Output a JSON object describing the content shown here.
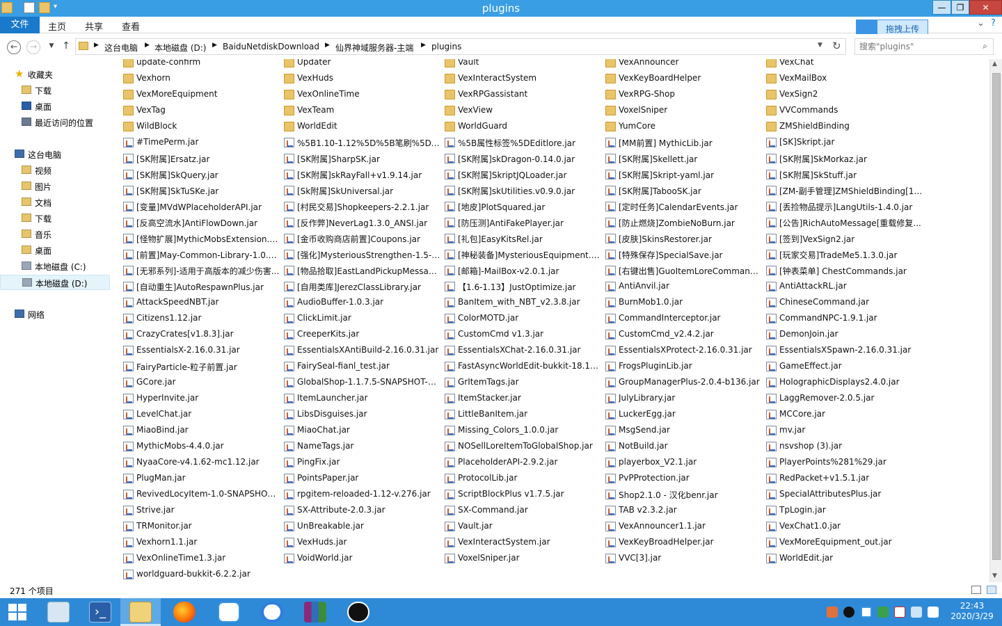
{
  "window": {
    "title": "plugins",
    "minimize": "—",
    "maximize": "❐",
    "close": "✕"
  },
  "ribbon": {
    "tabs": [
      "文件",
      "主页",
      "共享",
      "查看"
    ],
    "upload_label": "拖拽上传",
    "expand": "⌄",
    "help": "?"
  },
  "address": {
    "crumbs": [
      "这台电脑",
      "本地磁盘 (D:)",
      "BaiduNetdiskDownload",
      "仙界神域服务器-主端",
      "plugins"
    ],
    "search_placeholder": "搜索\"plugins\""
  },
  "nav": [
    {
      "label": "收藏夹",
      "icon": "star-icon",
      "group": true
    },
    {
      "label": "下载",
      "icon": "downloads-folder-icon"
    },
    {
      "label": "桌面",
      "icon": "desktop-icon"
    },
    {
      "label": "最近访问的位置",
      "icon": "recent-places-icon"
    },
    {
      "label": "这台电脑",
      "icon": "computer-icon",
      "group": true
    },
    {
      "label": "视频",
      "icon": "videos-folder-icon"
    },
    {
      "label": "图片",
      "icon": "pictures-folder-icon"
    },
    {
      "label": "文档",
      "icon": "documents-folder-icon"
    },
    {
      "label": "下载",
      "icon": "downloads-folder-icon"
    },
    {
      "label": "音乐",
      "icon": "music-folder-icon"
    },
    {
      "label": "桌面",
      "icon": "desktop-folder-icon"
    },
    {
      "label": "本地磁盘 (C:)",
      "icon": "drive-c-icon"
    },
    {
      "label": "本地磁盘 (D:)",
      "icon": "drive-d-icon",
      "selected": true
    },
    {
      "label": "网络",
      "icon": "network-icon",
      "group": true
    }
  ],
  "files": [
    [
      "update-confirm",
      "folder"
    ],
    [
      "Updater",
      "folder"
    ],
    [
      "Vault",
      "folder"
    ],
    [
      "VexAnnouncer",
      "folder"
    ],
    [
      "VexChat",
      "folder"
    ],
    [
      "Vexhorn",
      "folder"
    ],
    [
      "VexHuds",
      "folder"
    ],
    [
      "VexInteractSystem",
      "folder"
    ],
    [
      "VexKeyBoardHelper",
      "folder"
    ],
    [
      "VexMailBox",
      "folder"
    ],
    [
      "VexMoreEquipment",
      "folder"
    ],
    [
      "VexOnlineTime",
      "folder"
    ],
    [
      "VexRPGassistant",
      "folder"
    ],
    [
      "VexRPG-Shop",
      "folder"
    ],
    [
      "VexSign2",
      "folder"
    ],
    [
      "VexTag",
      "folder"
    ],
    [
      "VexTeam",
      "folder"
    ],
    [
      "VexView",
      "folder"
    ],
    [
      "VoxelSniper",
      "folder"
    ],
    [
      "VVCommands",
      "folder"
    ],
    [
      "WildBlock",
      "folder"
    ],
    [
      "WorldEdit",
      "folder"
    ],
    [
      "WorldGuard",
      "folder"
    ],
    [
      "YumCore",
      "folder"
    ],
    [
      "ZMShieldBinding",
      "folder"
    ],
    [
      "#TimePerm.jar",
      "jar"
    ],
    [
      "%5B1.10-1.12%5D%5B笔刷%5DV...",
      "jar"
    ],
    [
      "%5B属性标签%5DEditlore.jar",
      "jar"
    ],
    [
      "[MM前置]  MythicLib.jar",
      "jar"
    ],
    [
      "[SK]Skript.jar",
      "jar"
    ],
    [
      "[SK附属]Ersatz.jar",
      "jar"
    ],
    [
      "[SK附属]SharpSK.jar",
      "jar"
    ],
    [
      "[SK附属]skDragon-0.14.0.jar",
      "jar"
    ],
    [
      "[SK附属]Skellett.jar",
      "jar"
    ],
    [
      "[SK附属]SkMorkaz.jar",
      "jar"
    ],
    [
      "[SK附属]SkQuery.jar",
      "jar"
    ],
    [
      "[SK附属]skRayFall+v1.9.14.jar",
      "jar"
    ],
    [
      "[SK附属]SkriptJQLoader.jar",
      "jar"
    ],
    [
      "[SK附属]Skript-yaml.jar",
      "jar"
    ],
    [
      "[SK附属]SkStuff.jar",
      "jar"
    ],
    [
      "[SK附属]SkTuSKe.jar",
      "jar"
    ],
    [
      "[Sk附属]SkUniversal.jar",
      "jar"
    ],
    [
      "[SK附属]skUtilities.v0.9.0.jar",
      "jar"
    ],
    [
      "[SK附属]TabooSK.jar",
      "jar"
    ],
    [
      "[ZM-副手管理]ZMShieldBinding[1....",
      "jar"
    ],
    [
      "[变量]MVdWPlaceholderAPI.jar",
      "jar"
    ],
    [
      "[村民交易]Shopkeepers-2.2.1.jar",
      "jar"
    ],
    [
      "[地皮]PlotSquared.jar",
      "jar"
    ],
    [
      "[定时任务]CalendarEvents.jar",
      "jar"
    ],
    [
      "[丢捡物品提示]LangUtils-1.4.0.jar",
      "jar"
    ],
    [
      "[反高空流水]AntiFlowDown.jar",
      "jar"
    ],
    [
      "[反作弊]NeverLag1.3.0_ANSI.jar",
      "jar"
    ],
    [
      "[防压测]AntiFakePlayer.jar",
      "jar"
    ],
    [
      "[防止燃烧]ZombieNoBurn.jar",
      "jar"
    ],
    [
      "[公告]RichAutoMessage[重载修复...",
      "jar"
    ],
    [
      "[怪物扩展]MythicMobsExtension.jar",
      "jar"
    ],
    [
      "[金币收购商店前置]Coupons.jar",
      "jar"
    ],
    [
      "[礼包]EasyKitsRel.jar",
      "jar"
    ],
    [
      "[皮肤]SkinsRestorer.jar",
      "jar"
    ],
    [
      "[签到]VexSign2.jar",
      "jar"
    ],
    [
      "[前置]May-Common-Library-1.0.1....",
      "jar"
    ],
    [
      "[强化]MysteriousStrengthen-1.5-S...",
      "jar"
    ],
    [
      "[神秘装备]MysteriousEquipment.jar",
      "jar"
    ],
    [
      "[特殊保存]SpecialSave.jar",
      "jar"
    ],
    [
      "[玩家交易]TradeMe5.1.3.0.jar",
      "jar"
    ],
    [
      "[无邪系列]-适用于高版本的减少伤害...",
      "jar"
    ],
    [
      "[物品拾取]EastLandPickupMessag...",
      "jar"
    ],
    [
      "[邮箱]-MailBox-v2.0.1.jar",
      "jar"
    ],
    [
      "[右键出售]GuoItemLoreCommand...",
      "jar"
    ],
    [
      "[钟表菜单]  ChestCommands.jar",
      "jar"
    ],
    [
      "[自动重生]AutoRespawnPlus.jar",
      "jar"
    ],
    [
      "[自用类库]JerezClassLibrary.jar",
      "jar"
    ],
    [
      "【1.6-1.13】JustOptimize.jar",
      "jar"
    ],
    [
      "AntiAnvil.jar",
      "jar"
    ],
    [
      "AntiAttackRL.jar",
      "jar"
    ],
    [
      "AttackSpeedNBT.jar",
      "jar"
    ],
    [
      "AudioBuffer-1.0.3.jar",
      "jar"
    ],
    [
      "BanItem_with_NBT_v2.3.8.jar",
      "jar"
    ],
    [
      "BurnMob1.0.jar",
      "jar"
    ],
    [
      "ChineseCommand.jar",
      "jar"
    ],
    [
      "Citizens1.12.jar",
      "jar"
    ],
    [
      "ClickLimit.jar",
      "jar"
    ],
    [
      "ColorMOTD.jar",
      "jar"
    ],
    [
      "CommandInterceptor.jar",
      "jar"
    ],
    [
      "CommandNPC-1.9.1.jar",
      "jar"
    ],
    [
      "CrazyCrates[v1.8.3].jar",
      "jar"
    ],
    [
      "CreeperKits.jar",
      "jar"
    ],
    [
      "CustomCmd v1.3.jar",
      "jar"
    ],
    [
      "CustomCmd_v2.4.2.jar",
      "jar"
    ],
    [
      "DemonJoin.jar",
      "jar"
    ],
    [
      "EssentialsX-2.16.0.31.jar",
      "jar"
    ],
    [
      "EssentialsXAntiBuild-2.16.0.31.jar",
      "jar"
    ],
    [
      "EssentialsXChat-2.16.0.31.jar",
      "jar"
    ],
    [
      "EssentialsXProtect-2.16.0.31.jar",
      "jar"
    ],
    [
      "EssentialsXSpawn-2.16.0.31.jar",
      "jar"
    ],
    [
      "FairyParticle-粒子前置.jar",
      "jar"
    ],
    [
      "FairySeal-fianl_test.jar",
      "jar"
    ],
    [
      "FastAsyncWorldEdit-bukkit-18.12...",
      "jar"
    ],
    [
      "FrogsPluginLib.jar",
      "jar"
    ],
    [
      "GameEffect.jar",
      "jar"
    ],
    [
      "GCore.jar",
      "jar"
    ],
    [
      "GlobalShop-1.1.7.5-SNAPSHOT-o...",
      "jar"
    ],
    [
      "GrItemTags.jar",
      "jar"
    ],
    [
      "GroupManagerPlus-2.0.4-b136.jar",
      "jar"
    ],
    [
      "HolographicDisplays2.4.0.jar",
      "jar"
    ],
    [
      "HyperInvite.jar",
      "jar"
    ],
    [
      "ItemLauncher.jar",
      "jar"
    ],
    [
      "ItemStacker.jar",
      "jar"
    ],
    [
      "JulyLibrary.jar",
      "jar"
    ],
    [
      "LaggRemover-2.0.5.jar",
      "jar"
    ],
    [
      "LevelChat.jar",
      "jar"
    ],
    [
      "LibsDisguises.jar",
      "jar"
    ],
    [
      "LittleBanItem.jar",
      "jar"
    ],
    [
      "LuckerEgg.jar",
      "jar"
    ],
    [
      "MCCore.jar",
      "jar"
    ],
    [
      "MiaoBind.jar",
      "jar"
    ],
    [
      "MiaoChat.jar",
      "jar"
    ],
    [
      "Missing_Colors_1.0.0.jar",
      "jar"
    ],
    [
      "MsgSend.jar",
      "jar"
    ],
    [
      "mv.jar",
      "jar"
    ],
    [
      "MythicMobs-4.4.0.jar",
      "jar"
    ],
    [
      "NameTags.jar",
      "jar"
    ],
    [
      "NOSellLoreItemToGlobalShop.jar",
      "jar"
    ],
    [
      "NotBuild.jar",
      "jar"
    ],
    [
      "nsvshop (3).jar",
      "jar"
    ],
    [
      "NyaaCore-v4.1.62-mc1.12.jar",
      "jar"
    ],
    [
      "PingFix.jar",
      "jar"
    ],
    [
      "PlaceholderAPI-2.9.2.jar",
      "jar"
    ],
    [
      "playerbox_V2.1.jar",
      "jar"
    ],
    [
      "PlayerPoints%281%29.jar",
      "jar"
    ],
    [
      "PlugMan.jar",
      "jar"
    ],
    [
      "PointsPaper.jar",
      "jar"
    ],
    [
      "ProtocolLib.jar",
      "jar"
    ],
    [
      "PvPProtection.jar",
      "jar"
    ],
    [
      "RedPacket+v1.5.1.jar",
      "jar"
    ],
    [
      "RevivedLocyItem-1.0-SNAPSHOT....",
      "jar"
    ],
    [
      "rpgitem-reloaded-1.12-v.276.jar",
      "jar"
    ],
    [
      "ScriptBlockPlus v1.7.5.jar",
      "jar"
    ],
    [
      "Shop2.1.0 - 汉化benr.jar",
      "jar"
    ],
    [
      "SpecialAttributesPlus.jar",
      "jar"
    ],
    [
      "Strive.jar",
      "jar"
    ],
    [
      "SX-Attribute-2.0.3.jar",
      "jar"
    ],
    [
      "SX-Command.jar",
      "jar"
    ],
    [
      "TAB v2.3.2.jar",
      "jar"
    ],
    [
      "TpLogin.jar",
      "jar"
    ],
    [
      "TRMonitor.jar",
      "jar"
    ],
    [
      "UnBreakable.jar",
      "jar"
    ],
    [
      "Vault.jar",
      "jar"
    ],
    [
      "VexAnnouncer1.1.jar",
      "jar"
    ],
    [
      "VexChat1.0.jar",
      "jar"
    ],
    [
      "Vexhorn1.1.jar",
      "jar"
    ],
    [
      "VexHuds.jar",
      "jar"
    ],
    [
      "VexInteractSystem.jar",
      "jar"
    ],
    [
      "VexKeyBroadHelper.jar",
      "jar"
    ],
    [
      "VexMoreEquipment_out.jar",
      "jar"
    ],
    [
      "VexOnlineTime1.3.jar",
      "jar"
    ],
    [
      "VoidWorld.jar",
      "jar"
    ],
    [
      "VoxelSniper.jar",
      "jar"
    ],
    [
      "VVC[3].jar",
      "jar"
    ],
    [
      "WorldEdit.jar",
      "jar"
    ],
    [
      "worldguard-bukkit-6.2.2.jar",
      "jar"
    ]
  ],
  "status": {
    "item_count": "271 个项目"
  },
  "taskbar": {
    "apps": [
      "start-button",
      "server-manager-icon",
      "powershell-icon",
      "file-explorer-icon",
      "firefox-icon",
      "baidu-netdisk-icon",
      "sogou-icon",
      "winrar-icon",
      "game-launcher-icon"
    ],
    "time": "22:43",
    "date": "2020/3/29"
  },
  "colors": {
    "title_bar": "#3a9ee4",
    "file_tab": "#1979ca",
    "taskbar": "#2e8ad7",
    "close": "#c7463f"
  }
}
